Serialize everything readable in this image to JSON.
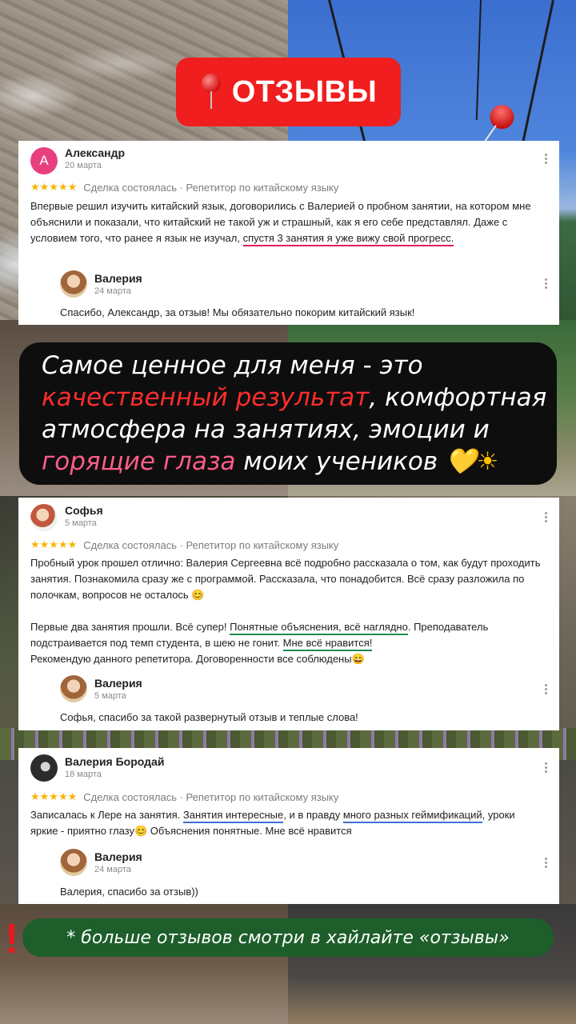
{
  "header": {
    "title": "ОТЗЫВЫ",
    "pin_icon": "pushpin-icon"
  },
  "reviews": [
    {
      "author": "Александр",
      "avatar_letter": "А",
      "date": "20 марта",
      "stars": "★★★★★",
      "status": "Сделка состоялась · Репетитор по китайскому языку",
      "text_plain": "Впервые решил изучить китайский язык, договорились с Валерией о пробном занятии, на котором мне объяснили и показали, что китайский не такой уж и страшный, как я его себе представлял. Даже с условием того, что ранее я язык не изучал, ",
      "text_highlight": "спустя 3 занятия я уже вижу свой прогресс.",
      "reply": {
        "author": "Валерия",
        "date": "24 марта",
        "text": "Спасибо, Александр, за отзыв! Мы обязательно покорим китайский язык!"
      }
    },
    {
      "author": "Софья",
      "date": "5 марта",
      "stars": "★★★★★",
      "status": "Сделка состоялась · Репетитор по китайскому языку",
      "para1": "Пробный урок прошел отлично: Валерия Сергеевна всё подробно рассказала о том, как будут проходить занятия. Познакомила сразу же с программой. Рассказала, что понадобится. Всё сразу разложила по полочкам, вопросов не осталось 😊",
      "para2_a": "Первые два занятия прошли. Всё супер! ",
      "para2_h1": "Понятные объяснения, всё наглядно",
      "para2_b": ". Преподаватель подстраивается под темп студента, в шею не гонит. ",
      "para2_h2": "Мне всё нравится!",
      "para2_c": "Рекомендую данного репетитора. Договоренности все соблюдены😄",
      "reply": {
        "author": "Валерия",
        "date": "5 марта",
        "text": "Софья, спасибо за такой развернутый отзыв и теплые слова!"
      }
    },
    {
      "author": "Валерия Бородай",
      "date": "18 марта",
      "stars": "★★★★★",
      "status": "Сделка состоялась · Репетитор по китайскому языку",
      "text_a": "Записалась к Лере на занятия. ",
      "text_h1": "Занятия интересные",
      "text_b": ", и в правду ",
      "text_h2": "много разных геймификаций",
      "text_c": ", уроки яркие - приятно глазу😊 Объяснения понятные. Мне всё нравится",
      "reply": {
        "author": "Валерия",
        "date": "24 марта",
        "text": "Валерия, спасибо за отзыв))"
      }
    }
  ],
  "quote": {
    "part1": "Самое ценное для меня - это ",
    "red": "качественный результат",
    "part2": ", комфортная атмосфера на занятиях, эмоции и ",
    "pink": "горящие глаза",
    "part3": " моих учеников ",
    "heart": "💛",
    "sun": "☀"
  },
  "footer": {
    "text": "* больше отзывов смотри в хайлайте «отзывы»",
    "bang": "!"
  },
  "colors": {
    "title_bg": "#f01e1e",
    "footer_bg": "#1d5e2a",
    "star": "#f7b500",
    "highlight_red": "#ff2d2d",
    "highlight_pink": "#ff5c8a"
  }
}
